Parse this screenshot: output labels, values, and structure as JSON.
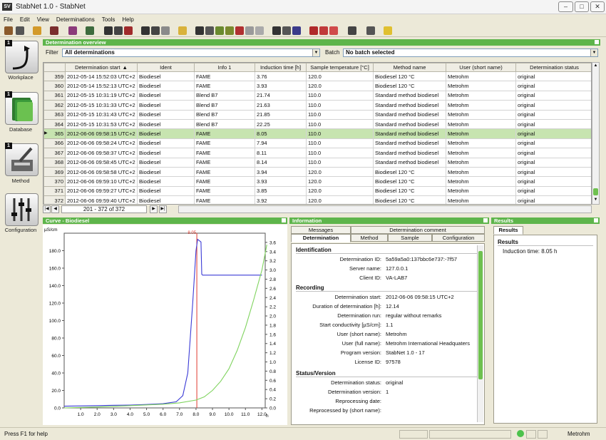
{
  "window": {
    "title": "StabNet 1.0 - StabNet",
    "logo": "SV"
  },
  "menu": [
    "File",
    "Edit",
    "View",
    "Determinations",
    "Tools",
    "Help"
  ],
  "nav": [
    {
      "num": "1",
      "label": "Workplace"
    },
    {
      "num": "1",
      "label": "Database"
    },
    {
      "num": "1",
      "label": "Method"
    },
    {
      "num": "",
      "label": "Configuration"
    }
  ],
  "overview": {
    "title": "Determination overview",
    "filter_label": "Filter",
    "filter_value": "All determinations",
    "batch_label": "Batch",
    "batch_value": "No batch selected",
    "columns": [
      "",
      "Determination start",
      "Ident",
      "Info 1",
      "Induction time [h]",
      "Sample temperature [°C]",
      "Method name",
      "User (short name)",
      "Determination status"
    ],
    "sort_indicator": "▲",
    "rows": [
      [
        "359",
        "2012-05-14 15:52:03 UTC+2",
        "Biodiesel",
        "FAME",
        "3.76",
        "120.0",
        "Biodiesel 120 °C",
        "Metrohm",
        "original"
      ],
      [
        "360",
        "2012-05-14 15:52:13 UTC+2",
        "Biodiesel",
        "FAME",
        "3.93",
        "120.0",
        "Biodiesel 120 °C",
        "Metrohm",
        "original"
      ],
      [
        "361",
        "2012-05-15 10:31:19 UTC+2",
        "Biodiesel",
        "Blend B7",
        "21.74",
        "110.0",
        "Standard method biodiesel",
        "Metrohm",
        "original"
      ],
      [
        "362",
        "2012-05-15 10:31:33 UTC+2",
        "Biodiesel",
        "Blend B7",
        "21.63",
        "110.0",
        "Standard method biodiesel",
        "Metrohm",
        "original"
      ],
      [
        "363",
        "2012-05-15 10:31:43 UTC+2",
        "Biodiesel",
        "Blend B7",
        "21.85",
        "110.0",
        "Standard method biodiesel",
        "Metrohm",
        "original"
      ],
      [
        "364",
        "2012-05-15 10:31:53 UTC+2",
        "Biodiesel",
        "Blend B7",
        "22.25",
        "110.0",
        "Standard method biodiesel",
        "Metrohm",
        "original"
      ],
      [
        "365",
        "2012-06-06 09:58:15 UTC+2",
        "Biodiesel",
        "FAME",
        "8.05",
        "110.0",
        "Standard method biodiesel",
        "Metrohm",
        "original"
      ],
      [
        "366",
        "2012-06-06 09:58:24 UTC+2",
        "Biodiesel",
        "FAME",
        "7.94",
        "110.0",
        "Standard method biodiesel",
        "Metrohm",
        "original"
      ],
      [
        "367",
        "2012-06-06 09:58:37 UTC+2",
        "Biodiesel",
        "FAME",
        "8.11",
        "110.0",
        "Standard method biodiesel",
        "Metrohm",
        "original"
      ],
      [
        "368",
        "2012-06-06 09:58:45 UTC+2",
        "Biodiesel",
        "FAME",
        "8.14",
        "110.0",
        "Standard method biodiesel",
        "Metrohm",
        "original"
      ],
      [
        "369",
        "2012-06-06 09:58:58 UTC+2",
        "Biodiesel",
        "FAME",
        "3.94",
        "120.0",
        "Biodiesel 120 °C",
        "Metrohm",
        "original"
      ],
      [
        "370",
        "2012-06-06 09:59:10 UTC+2",
        "Biodiesel",
        "FAME",
        "3.93",
        "120.0",
        "Biodiesel 120 °C",
        "Metrohm",
        "original"
      ],
      [
        "371",
        "2012-06-06 09:59:27 UTC+2",
        "Biodiesel",
        "FAME",
        "3.85",
        "120.0",
        "Biodiesel 120 °C",
        "Metrohm",
        "original"
      ],
      [
        "372",
        "2012-06-06 09:59:40 UTC+2",
        "Biodiesel",
        "FAME",
        "3.92",
        "120.0",
        "Biodiesel 120 °C",
        "Metrohm",
        "original"
      ]
    ],
    "selected_row": "365",
    "pager": "201 - 372 of 372"
  },
  "curve": {
    "title": "Curve - Biodiesel",
    "y_unit": "µS/cm",
    "x_unit": "h",
    "marker_label": "8.05",
    "accent": "#3b3bd6",
    "accent2": "#7fd35e"
  },
  "chart_data": {
    "type": "line",
    "xlabel": "h",
    "ylabel": "µS/cm",
    "xlim": [
      0,
      12.2
    ],
    "ylim": [
      0,
      200
    ],
    "y2lim": [
      0,
      3.8
    ],
    "x_ticks": [
      "1.0",
      "2.0",
      "3.0",
      "4.0",
      "5.0",
      "6.0",
      "7.0",
      "8.0",
      "9.0",
      "10.0",
      "11.0",
      "12.0"
    ],
    "y_ticks": [
      "0.0",
      "20.0",
      "40.0",
      "60.0",
      "80.0",
      "100.0",
      "120.0",
      "140.0",
      "160.0",
      "180.0"
    ],
    "y2_ticks": [
      "0.0",
      "0.2",
      "0.4",
      "0.6",
      "0.8",
      "1.0",
      "1.2",
      "1.4",
      "1.6",
      "1.8",
      "2.0",
      "2.2",
      "2.4",
      "2.6",
      "2.8",
      "3.0",
      "3.2",
      "3.4",
      "3.6"
    ],
    "marker_x": 8.05,
    "series": [
      {
        "axis": "left",
        "color": "#3b3bd6",
        "points": [
          [
            0,
            2
          ],
          [
            1,
            2.3
          ],
          [
            2,
            2.6
          ],
          [
            3,
            3
          ],
          [
            4,
            3.3
          ],
          [
            5,
            3.9
          ],
          [
            6,
            4.8
          ],
          [
            6.8,
            7
          ],
          [
            7.2,
            14
          ],
          [
            7.5,
            40
          ],
          [
            7.8,
            120
          ],
          [
            8.0,
            180
          ],
          [
            8.1,
            193
          ],
          [
            8.3,
            190
          ],
          [
            8.35,
            153
          ],
          [
            8.4,
            152
          ],
          [
            10,
            152
          ],
          [
            12.0,
            152
          ]
        ]
      },
      {
        "axis": "right",
        "color": "#7fd35e",
        "points": [
          [
            0,
            0
          ],
          [
            2,
            0.02
          ],
          [
            4,
            0.05
          ],
          [
            6,
            0.08
          ],
          [
            7,
            0.11
          ],
          [
            8,
            0.17
          ],
          [
            8.5,
            0.24
          ],
          [
            9,
            0.38
          ],
          [
            9.5,
            0.58
          ],
          [
            10,
            0.85
          ],
          [
            10.5,
            1.25
          ],
          [
            11,
            1.75
          ],
          [
            11.5,
            2.35
          ],
          [
            12,
            3.0
          ],
          [
            12.3,
            3.55
          ]
        ]
      }
    ]
  },
  "info": {
    "title": "Information",
    "tabs_top": [
      "Messages",
      "Determination comment"
    ],
    "tabs_bottom": [
      "Determination",
      "Method",
      "Sample",
      "Configuration"
    ],
    "sections": {
      "identification": "Identification",
      "recording": "Recording",
      "status": "Status/Version"
    },
    "fields": [
      {
        "label": "Determination ID:",
        "value": "5a59a5a0:137bbc6e737:-7f57"
      },
      {
        "label": "Server name:",
        "value": "127.0.0.1"
      },
      {
        "label": "Client ID:",
        "value": "VA-LAB7"
      },
      {
        "label": "Determination start:",
        "value": "2012-06-06 09:58:15 UTC+2"
      },
      {
        "label": "Duration of determination [h]:",
        "value": "12.14"
      },
      {
        "label": "Determination run:",
        "value": "regular without remarks"
      },
      {
        "label": "Start conductivity [µS/cm]:",
        "value": "1.1"
      },
      {
        "label": "User (short name):",
        "value": "Metrohm"
      },
      {
        "label": "User (full name):",
        "value": "Metrohm International Headquaters"
      },
      {
        "label": "Program version:",
        "value": "StabNet 1.0 - 17"
      },
      {
        "label": "License ID:",
        "value": "97578"
      },
      {
        "label": "Determination status:",
        "value": "original"
      },
      {
        "label": "Determination version:",
        "value": "1"
      },
      {
        "label": "Reprocessing date:",
        "value": ""
      },
      {
        "label": "Reprocessed by (short name):",
        "value": ""
      }
    ]
  },
  "results": {
    "title": "Results",
    "tab": "Results",
    "group": "Results",
    "line": "Induction time: 8.05 h"
  },
  "status": {
    "help": "Press F1 for help",
    "user": "Metrohm"
  }
}
